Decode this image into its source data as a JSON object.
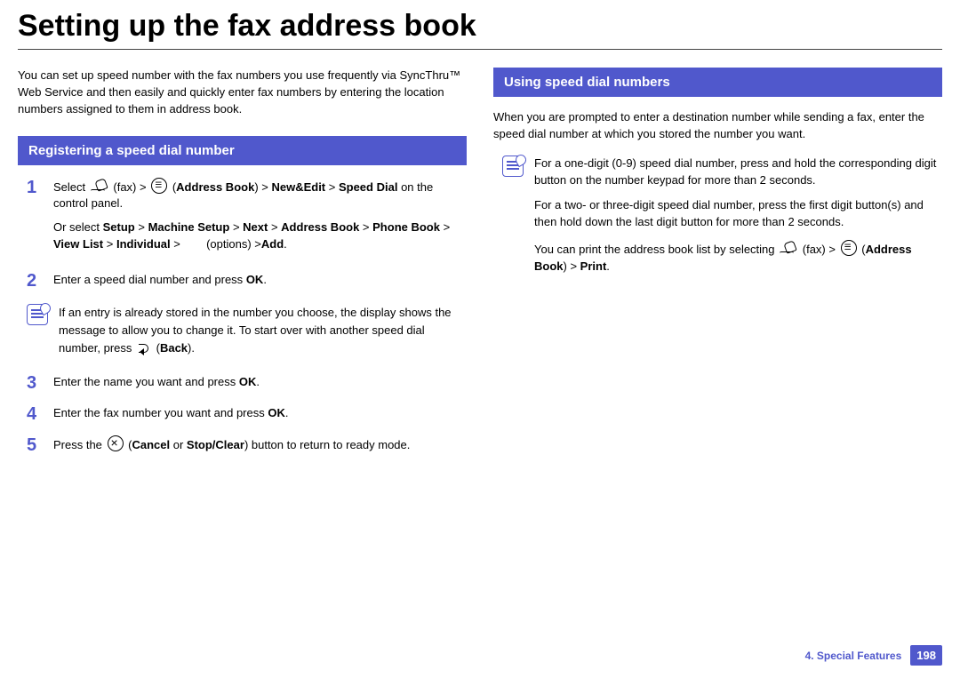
{
  "title": "Setting up the fax address book",
  "intro": "You can set up speed number with the fax numbers you use frequently via SyncThru™ Web Service and then easily and quickly enter fax numbers by entering the location numbers assigned to them in address book.",
  "left": {
    "heading": "Registering a speed dial number",
    "steps": {
      "s1a_pre": "Select ",
      "s1a_fax": " (fax) > ",
      "s1a_ab": " (",
      "s1a_ab_label": "Address Book",
      "s1a_mid": ") > ",
      "s1a_ne": "New&Edit",
      "s1a_mid2": " > ",
      "s1a_sd": "Speed Dial",
      "s1a_post": " on the control panel.",
      "s1b_pre": "Or select ",
      "s1b_setup": "Setup",
      "s1b_ms": "Machine Setup",
      "s1b_next": "Next",
      "s1b_ab": "Address Book",
      "s1b_pb": "Phone Book",
      "s1b_vl": "View List",
      "s1b_ind": "Individual",
      "s1b_opts": " (options) >",
      "s1b_add": "Add",
      "gt": " > ",
      "s2_pre": "Enter a speed dial number and press ",
      "s2_ok": "OK",
      "s3_pre": "Enter the name you want and press ",
      "s3_ok": "OK",
      "s4_pre": "Enter the fax number you want and press ",
      "s4_ok": "OK",
      "s5_pre": "Press the ",
      "s5_c": "Cancel",
      "s5_or": " or ",
      "s5_sc": "Stop/Clear",
      "s5_post": ") button to return to ready mode.",
      "dot": "."
    },
    "note": {
      "t1": "If an entry is already stored in the number you choose, the display shows the message to allow you to change it. To start over with another speed dial number, press ",
      "back": "Back",
      "t2": ")."
    }
  },
  "right": {
    "heading": "Using speed dial numbers",
    "intro": "When you are prompted to enter a destination number while sending a fax, enter the speed dial number at which you stored the number you want.",
    "note": {
      "p1": "For a one-digit (0-9) speed dial number, press and hold the corresponding digit button on the number keypad for more than 2 seconds.",
      "p2": "For a two- or three-digit speed dial number, press the first digit button(s) and then hold down the last digit button for more than 2 seconds.",
      "p3_pre": "You can print the address book list by selecting ",
      "p3_fax": " (fax) > ",
      "p3_ab_l": "Address Book",
      "p3_mid": ") > ",
      "p3_print": "Print",
      "dot": ".",
      "paren_open": " ("
    }
  },
  "footer": {
    "chapter": "4.  Special Features",
    "page": "198"
  }
}
